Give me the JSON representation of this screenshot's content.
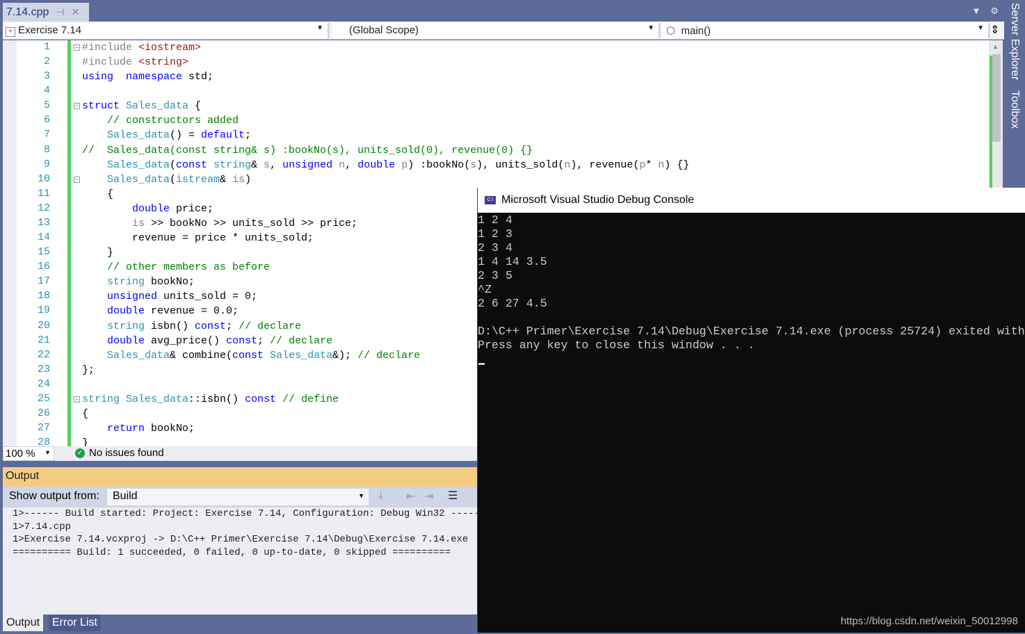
{
  "tab": {
    "title": "7.14.cpp",
    "pin_icon": "pin-icon",
    "close_icon": "close-icon"
  },
  "nav": {
    "project": "Exercise 7.14",
    "scope": "(Global Scope)",
    "member": "main()"
  },
  "side_panels": [
    "Server Explorer",
    "Toolbox"
  ],
  "code": [
    [
      [
        "p",
        "#include "
      ],
      [
        "s",
        "<iostream>"
      ]
    ],
    [
      [
        "p",
        "#include "
      ],
      [
        "s",
        "<string>"
      ]
    ],
    [
      [
        "k",
        "using"
      ],
      [
        "",
        "  "
      ],
      [
        "k",
        "namespace"
      ],
      [
        "",
        " std;"
      ]
    ],
    [],
    [
      [
        "k",
        "struct"
      ],
      [
        "",
        " "
      ],
      [
        "t",
        "Sales_data"
      ],
      [
        "",
        " {"
      ]
    ],
    [
      [
        "",
        "    "
      ],
      [
        "c",
        "// constructors added"
      ]
    ],
    [
      [
        "",
        "    "
      ],
      [
        "t",
        "Sales_data"
      ],
      [
        "",
        "() = "
      ],
      [
        "k",
        "default"
      ],
      [
        "",
        ";"
      ]
    ],
    [
      [
        "c",
        "//  Sales_data(const string& s) :bookNo(s), units_sold(0), revenue(0) {}"
      ]
    ],
    [
      [
        "",
        "    "
      ],
      [
        "t",
        "Sales_data"
      ],
      [
        "",
        "("
      ],
      [
        "k",
        "const"
      ],
      [
        "",
        " "
      ],
      [
        "t",
        "string"
      ],
      [
        "",
        "& "
      ],
      [
        "m",
        "s"
      ],
      [
        "",
        ", "
      ],
      [
        "k",
        "unsigned"
      ],
      [
        "",
        " "
      ],
      [
        "m",
        "n"
      ],
      [
        "",
        ", "
      ],
      [
        "k",
        "double"
      ],
      [
        "",
        " "
      ],
      [
        "m",
        "p"
      ],
      [
        "",
        ") :bookNo("
      ],
      [
        "m",
        "s"
      ],
      [
        "",
        "), units_sold("
      ],
      [
        "m",
        "n"
      ],
      [
        "",
        "), revenue("
      ],
      [
        "m",
        "p"
      ],
      [
        "",
        "* "
      ],
      [
        "m",
        "n"
      ],
      [
        "",
        ") {}"
      ]
    ],
    [
      [
        "",
        "    "
      ],
      [
        "t",
        "Sales_data"
      ],
      [
        "",
        "("
      ],
      [
        "t",
        "istream"
      ],
      [
        "",
        "& "
      ],
      [
        "m",
        "is"
      ],
      [
        "",
        ")"
      ]
    ],
    [
      [
        "",
        "    {"
      ]
    ],
    [
      [
        "",
        "        "
      ],
      [
        "k",
        "double"
      ],
      [
        "",
        " price;"
      ]
    ],
    [
      [
        "",
        "        "
      ],
      [
        "m",
        "is"
      ],
      [
        "",
        " >> bookNo >> units_sold >> price;"
      ]
    ],
    [
      [
        "",
        "        revenue = price * units_sold;"
      ]
    ],
    [
      [
        "",
        "    }"
      ]
    ],
    [
      [
        "",
        "    "
      ],
      [
        "c",
        "// other members as before"
      ]
    ],
    [
      [
        "",
        "    "
      ],
      [
        "t",
        "string"
      ],
      [
        "",
        " bookNo;"
      ]
    ],
    [
      [
        "",
        "    "
      ],
      [
        "k",
        "unsigned"
      ],
      [
        "",
        " units_sold = 0;"
      ]
    ],
    [
      [
        "",
        "    "
      ],
      [
        "k",
        "double"
      ],
      [
        "",
        " revenue = 0.0;"
      ]
    ],
    [
      [
        "",
        "    "
      ],
      [
        "t",
        "string"
      ],
      [
        "",
        " isbn() "
      ],
      [
        "k",
        "const"
      ],
      [
        "",
        "; "
      ],
      [
        "c",
        "// declare"
      ]
    ],
    [
      [
        "",
        "    "
      ],
      [
        "k",
        "double"
      ],
      [
        "",
        " avg_price() "
      ],
      [
        "k",
        "const"
      ],
      [
        "",
        "; "
      ],
      [
        "c",
        "// declare"
      ]
    ],
    [
      [
        "",
        "    "
      ],
      [
        "t",
        "Sales_data"
      ],
      [
        "",
        "& combine("
      ],
      [
        "k",
        "const"
      ],
      [
        "",
        " "
      ],
      [
        "t",
        "Sales_data"
      ],
      [
        "",
        "&); "
      ],
      [
        "c",
        "// declare"
      ]
    ],
    [
      [
        "",
        "};"
      ]
    ],
    [],
    [
      [
        "t",
        "string"
      ],
      [
        "",
        " "
      ],
      [
        "t",
        "Sales_data"
      ],
      [
        "",
        "::isbn() "
      ],
      [
        "k",
        "const"
      ],
      [
        "",
        " "
      ],
      [
        "c",
        "// define"
      ]
    ],
    [
      [
        "",
        "{"
      ]
    ],
    [
      [
        "",
        "    "
      ],
      [
        "k",
        "return"
      ],
      [
        "",
        " bookNo;"
      ]
    ],
    [
      [
        "",
        "}"
      ]
    ]
  ],
  "status": {
    "zoom": "100 %",
    "issues": "No issues found"
  },
  "output": {
    "title": "Output",
    "show_from_label": "Show output from:",
    "source": "Build",
    "lines": [
      "1>------ Build started: Project: Exercise 7.14, Configuration: Debug Win32 ------",
      "1>7.14.cpp",
      "1>Exercise 7.14.vcxproj -> D:\\C++ Primer\\Exercise 7.14\\Debug\\Exercise 7.14.exe",
      "========== Build: 1 succeeded, 0 failed, 0 up-to-date, 0 skipped =========="
    ]
  },
  "bottom_tabs": [
    "Output",
    "Error List"
  ],
  "console": {
    "title": "Microsoft Visual Studio Debug Console",
    "lines": [
      "1 2 4",
      "1 2 3",
      "2 3 4",
      "1 4 14 3.5",
      "2 3 5",
      "^Z",
      "2 6 27 4.5",
      "",
      "D:\\C++ Primer\\Exercise 7.14\\Debug\\Exercise 7.14.exe (process 25724) exited with",
      "Press any key to close this window . . ."
    ]
  },
  "watermark": "https://blog.csdn.net/weixin_50012998",
  "colors": {
    "chrome": "#5d6b99",
    "output_header": "#f5cc84",
    "change_bar": "#57d05d",
    "keyword": "#0000ff",
    "type": "#2b91af",
    "comment": "#008000",
    "string": "#a31515"
  }
}
